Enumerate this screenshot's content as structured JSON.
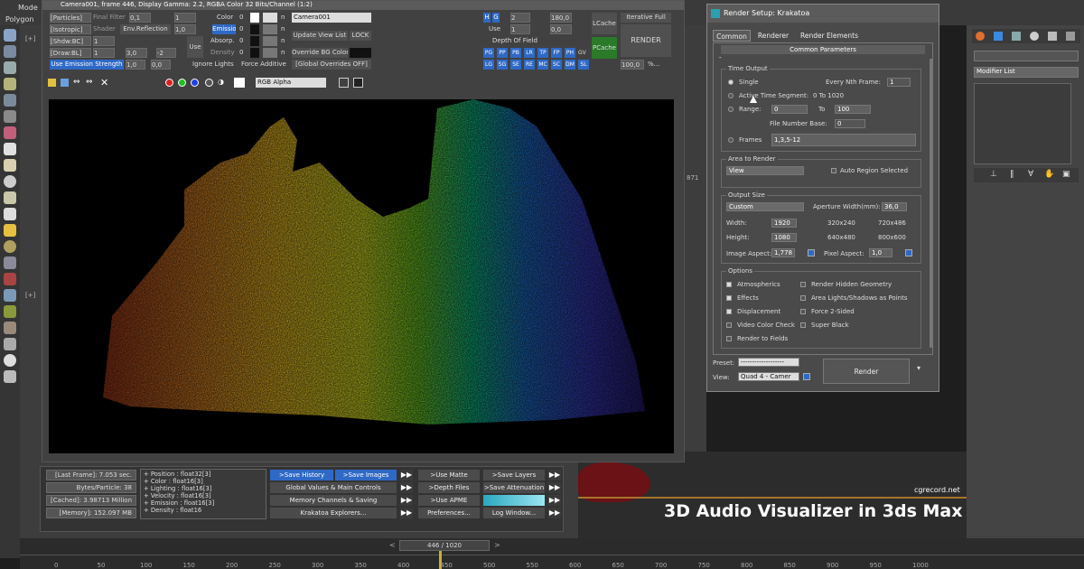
{
  "app": {
    "menu_mode": "Mode",
    "menu_polygon": "Polygon",
    "viewport_plus_1": "[+]",
    "viewport_plus_2": "[+]",
    "coord_871": "871"
  },
  "vfb": {
    "title": "Camera001, frame 446, Display Gamma: 2.2, RGBA Color 32 Bits/Channel (1:2)",
    "row1": [
      "[Particles]",
      "Final Filter",
      "0,1",
      "0",
      "1",
      "0",
      "Color",
      "0",
      "n"
    ],
    "row2": [
      "[Isotropic]",
      "Shader",
      "Env.Reflection",
      "1,0",
      "0",
      "Emission",
      "0",
      "n"
    ],
    "row3": [
      "[Shdw:BC]",
      "1",
      "0",
      "0",
      "0",
      "0",
      "Absorp.",
      "0",
      "n"
    ],
    "row4": [
      "[Draw:BL]",
      "1",
      "3,0",
      "0",
      "-2",
      "1",
      "Density",
      "0",
      "n"
    ],
    "use_label": "Use",
    "use_emission": "Use Emission Strength",
    "use_emission_v1": "1,0",
    "use_emission_v2": "0,0",
    "ignore_lights": "Ignore Lights",
    "force_additive": "Force Additive",
    "camera_select": "Camera001",
    "update_view_list": "Update View List",
    "lock": "LOCK",
    "override_bg": "Override BG Color",
    "global_overrides": "[Global Overrides OFF]",
    "r_h": "H",
    "r_g": "G",
    "r_val2": "2",
    "r_180": "180,0",
    "r_use": "Use",
    "r_1": "1",
    "r_00": "0,0",
    "depth_of_field": "Depth Of Field",
    "r_row_a": [
      "PG",
      "PP",
      "PB",
      "LR",
      "TP",
      "FP",
      "PH",
      "GV"
    ],
    "r_row_b": [
      "LG",
      "SG",
      "SE",
      "RE",
      "MC",
      "SC",
      "DM",
      "SL"
    ],
    "r_100": "100,0",
    "r_pct": "%...",
    "lcache": "LCache",
    "pcache": "PCache",
    "iterative": "Iterative Full",
    "render_btn": "RENDER",
    "rgb_alpha": "RGB Alpha"
  },
  "stats": {
    "last_frame": "[Last Frame]: 7.053 sec.",
    "bytes": "Bytes/Particle: 38",
    "cached": "[Cached]: 3.98713 Million",
    "memory": "[Memory]: 152.097 MB"
  },
  "channels": [
    "+ Position :  float32[3]",
    "+ Color :  float16[3]",
    "+ Lighting :  float16[3]",
    "+ Velocity :  float16[3]",
    "+ Emission :  float16[3]",
    "+ Density :  float16"
  ],
  "panel_buttons": {
    "save_history": ">Save History",
    "save_images": ">Save Images",
    "global_values": "Global Values & Main Controls",
    "memory_channels": "Memory Channels & Saving",
    "krakatoa_explorers": "Krakatoa Explorers...",
    "use_matte": ">Use Matte",
    "depth_files": ">Depth Files",
    "use_apme": ">Use APME",
    "preferences": "Preferences...",
    "save_layers": ">Save Layers",
    "save_attenuation": ">Save Attenuation",
    "log_window": "Log Window..."
  },
  "dialog": {
    "title": "Render Setup: Krakatoa",
    "tabs": [
      "Common",
      "Renderer",
      "Render Elements"
    ],
    "rollout": "Common Parameters",
    "time_output": "Time Output",
    "single": "Single",
    "every_nth": "Every Nth Frame:",
    "every_nth_val": "1",
    "active_time": "Active Time Segment:",
    "active_time_val": "0 To 1020",
    "range": "Range:",
    "range_from": "0",
    "to": "To",
    "range_to": "100",
    "file_number_base": "File Number Base:",
    "file_number_base_val": "0",
    "frames": "Frames",
    "frames_val": "1,3,5-12",
    "area_to_render": "Area to Render",
    "area_val": "View",
    "auto_region": "Auto Region Selected",
    "output_size": "Output Size",
    "output_val": "Custom",
    "aperture": "Aperture Width(mm):",
    "aperture_val": "36,0",
    "width": "Width:",
    "width_val": "1920",
    "height": "Height:",
    "height_val": "1080",
    "p320": "320x240",
    "p720": "720x486",
    "p640": "640x480",
    "p800": "800x600",
    "image_aspect": "Image Aspect:",
    "image_aspect_val": "1,778",
    "pixel_aspect": "Pixel Aspect:",
    "pixel_aspect_val": "1,0",
    "options": "Options",
    "atmospherics": "Atmospherics",
    "effects": "Effects",
    "displacement": "Displacement",
    "video_color": "Video Color Check",
    "render_fields": "Render to Fields",
    "hidden_geo": "Render Hidden Geometry",
    "area_lights": "Area Lights/Shadows as Points",
    "force2": "Force 2-Sided",
    "super_black": "Super Black",
    "preset": "Preset:",
    "preset_val": "-------------------",
    "view": "View:",
    "view_val": "Quad 4 - Camer",
    "render": "Render"
  },
  "modifier": {
    "label": "Modifier List"
  },
  "timeline": {
    "frame": "446 / 1020",
    "ticks": [
      "0",
      "50",
      "100",
      "150",
      "200",
      "250",
      "300",
      "350",
      "400",
      "450",
      "500",
      "550",
      "600",
      "650",
      "700",
      "750",
      "800",
      "850",
      "900",
      "950",
      "1000"
    ]
  },
  "overlay": {
    "credit": "cgrecord.net",
    "caption": "3D Audio Visualizer in 3ds Max"
  },
  "colors": {
    "accent_blue": "#2f69c6",
    "timeline_orange": "#a8742c",
    "red_particles": "#6a1216"
  }
}
